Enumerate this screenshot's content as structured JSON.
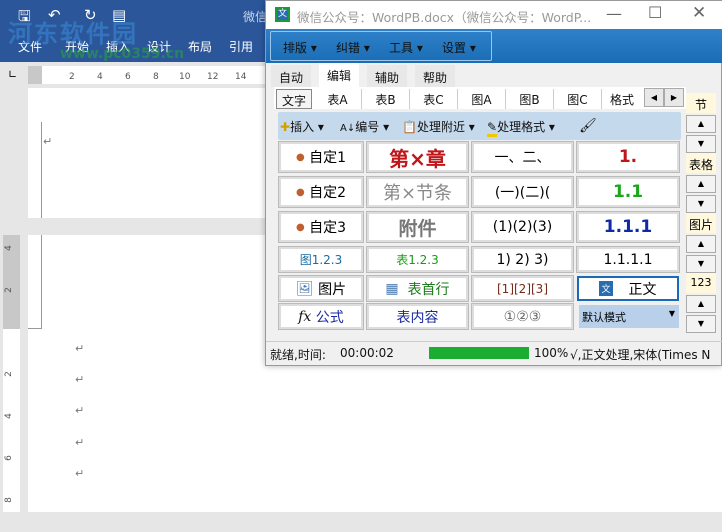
{
  "word": {
    "ribbon_tabs": [
      "文件",
      "开始",
      "插入",
      "设计",
      "布局",
      "引用"
    ],
    "title_partial": "微信",
    "ruler_ticks": [
      "2",
      "4",
      "6",
      "8",
      "10",
      "12",
      "14"
    ],
    "vruler_ticks": [
      "4",
      "2",
      "2",
      "4",
      "6",
      "8"
    ],
    "para_mark": "↵"
  },
  "watermark": {
    "name": "河东软件园",
    "url": "www.pc0359.cn"
  },
  "dialog": {
    "title": "微信公众号：WordPB.docx（微信公众号：WordP...",
    "menu": [
      "排版",
      "纠错",
      "工具",
      "设置"
    ],
    "tabs": [
      "自动",
      "编辑",
      "辅助",
      "帮助"
    ],
    "active_tab": "编辑",
    "subtabs": [
      "文字",
      "表A",
      "表B",
      "表C",
      "图A",
      "图B",
      "图C",
      "格式"
    ],
    "toolbar": [
      "插入",
      "编号",
      "处理附近",
      "处理格式"
    ],
    "grid": {
      "col1": [
        "自定1",
        "自定2",
        "自定3",
        "图1.2.3",
        "图片",
        "公式"
      ],
      "col2": [
        "第×章",
        "第×节条",
        "附件",
        "表1.2.3",
        "表首行",
        "表内容"
      ],
      "col3": [
        "一、二、",
        "(一)(二)(",
        "(1)(2)(3)",
        "1) 2) 3)",
        "[1][2][3]",
        "①②③"
      ],
      "col4": [
        "1.",
        "1.1",
        "1.1.1",
        "1.1.1.1",
        "正文"
      ],
      "mode_select": "默认模式"
    },
    "side": [
      "节",
      "表格",
      "图片",
      "123"
    ],
    "status": {
      "text": "就绪,时间:",
      "time": "00:00:02",
      "progress": 100,
      "progress_label": "100%",
      "info": "√,正文处理,宋体(Times N"
    },
    "colors": {
      "red": "#c0161a",
      "green": "#1aa81a",
      "blue": "#0d2aa8",
      "progress": "#1aad32"
    }
  }
}
